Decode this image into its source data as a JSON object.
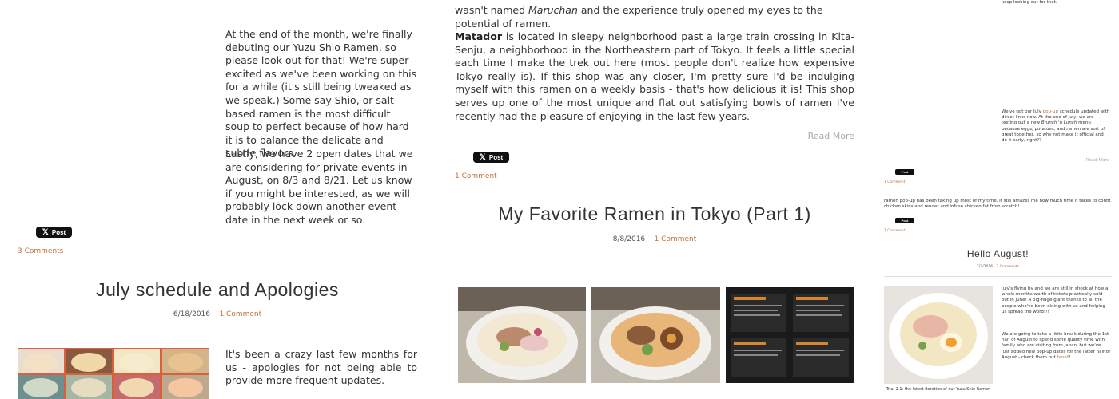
{
  "left_post": {
    "para1": "At the end of the month, we're finally debuting our Yuzu Shio Ramen, so please look out for that! We're super excited as we've been working on this for a while (it's still being tweaked as we speak.) Some say Shio, or salt-based ramen is the most difficult soup to perfect because of how hard it is to balance the delicate and subtle flavors.",
    "para2": "Lastly, we have 2 open dates that we are considering for private events in August, on 8/3 and 8/21. Let us know if you might be interested, as we will probably lock down another event date in the next week or so.",
    "tweet_label": "Post",
    "comments": "3 Comments"
  },
  "left_post2": {
    "title": "July schedule and Apologies",
    "date": "6/18/2016",
    "comments": "1 Comment",
    "intro": "It's been a crazy last few months for us - apologies for not being able to provide more frequent updates."
  },
  "center_post": {
    "top_line_pre": "wasn't named ",
    "top_line_em": "Maruchan",
    "top_line_post": " and the experience truly opened my eyes to the potential of ramen.",
    "matador_bold": "Matador",
    "matador_text": " is located in sleepy neighborhood past a large train crossing in Kita-Senju, a neighborhood in the Northeastern part of Tokyo. It feels a little special each time I make the trek out here (most people don't realize how expensive Tokyo really is). If this shop was any closer, I'm pretty sure I'd be indulging myself with this ramen on a weekly basis - that's how delicious it is! This shop serves up one of the most unique and flat out satisfying bowls of ramen I've recently had the pleasure of enjoying in the last few years.",
    "read_more": "Read More",
    "tweet_label": "Post",
    "comments": "1 Comment"
  },
  "center_post2": {
    "title": "My Favorite Ramen in Tokyo (Part 1)",
    "date": "8/8/2016",
    "comments": "1 Comment"
  },
  "right_col": {
    "top_text": "keep looking out for that.",
    "block1_pre": "We've got our July ",
    "block1_link": "pop-up",
    "block1_text": " schedule updated with direct links now. At the end of July, we are testing out a new ",
    "block1_em": "Brunch 'n Lunch",
    "block1_post": " menu because eggs, potatoes, and ramen are sort of great together, so why not make it official and do it early, right??",
    "read_more": "Read More",
    "tweet_label": "Post",
    "comments_a": "1 Comment",
    "block2": "ramen pop-up has been taking up most of my time. It still amazes me how much time it takes to confit chicken skins and render and infuse chicken fat from scratch!",
    "comments_b": "1 Comment",
    "title": "Hello August!",
    "date": "7/7/2016",
    "title_comments": "3 Comments",
    "para_a": "July's flying by and we are still in shock at how a whole months worth of tickets practically sold out in June! A big-huge-giant thanks to all the people who've been dining with us and helping us spread the word!!!",
    "para_b_pre": "We are going to take a little break during the 1st half of August to spend some quality time with family who are visiting from Japan, but we've just added new pop-up dates for the latter half of August - check them out ",
    "para_b_link": "here",
    "para_b_post": "!!",
    "caption": "Trial 2.1: the latest iteration of our Yuzu Shio Ramen"
  },
  "icons": {
    "tweet": "twitter-bird-icon"
  },
  "colors": {
    "link": "#c0703a",
    "tweet_bg": "#111111"
  }
}
